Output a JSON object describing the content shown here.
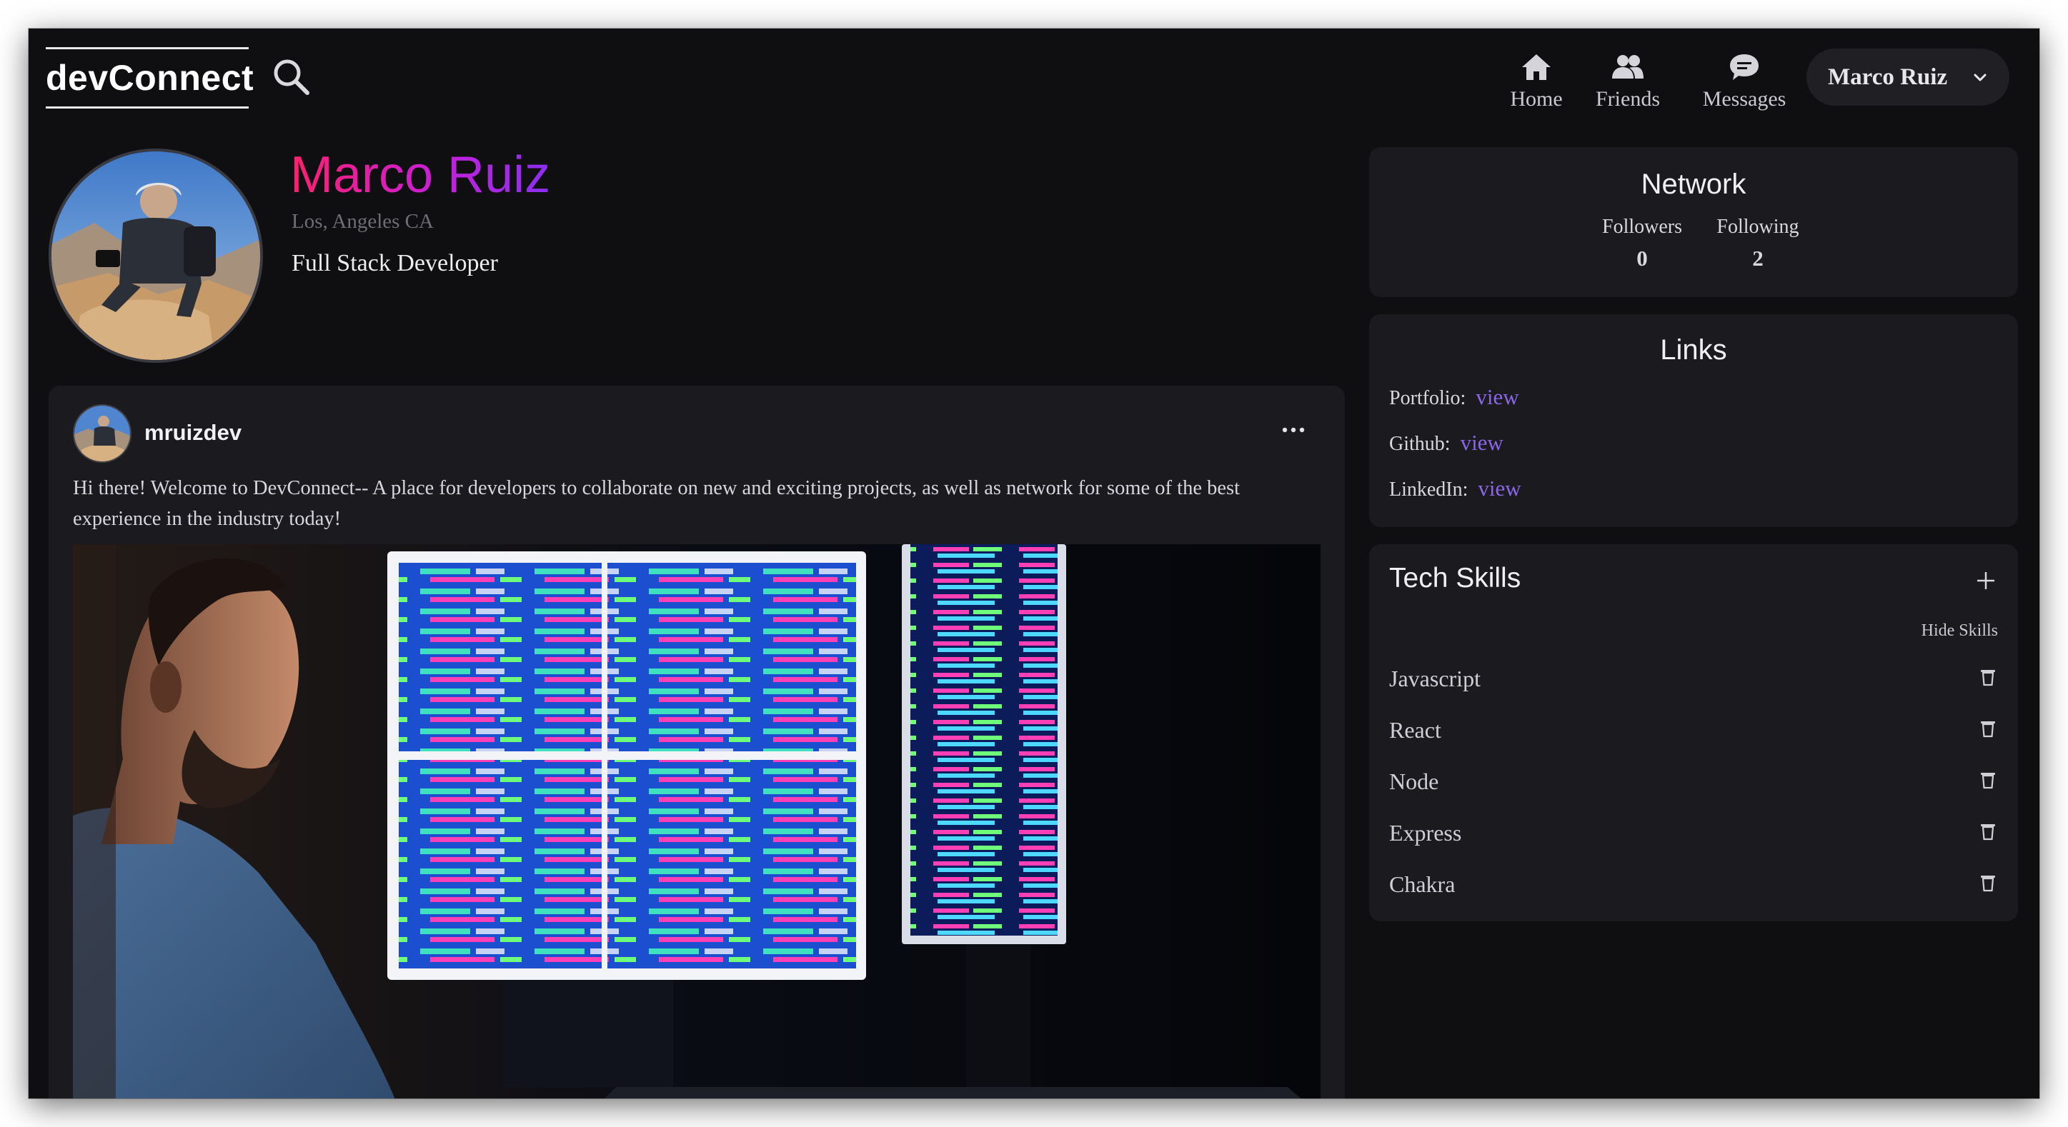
{
  "nav": {
    "logo": "devConnect",
    "items": [
      {
        "label": "Home",
        "icon": "home-icon"
      },
      {
        "label": "Friends",
        "icon": "friends-icon"
      },
      {
        "label": "Messages",
        "icon": "messages-icon"
      }
    ],
    "user_menu": "Marco Ruiz"
  },
  "profile": {
    "name": "Marco Ruiz",
    "location": "Los, Angeles CA",
    "role": "Full Stack Developer"
  },
  "post": {
    "username": "mruizdev",
    "text": "Hi there! Welcome to DevConnect-- A place for developers to collaborate on new and exciting projects, as well as network for some of the best experience in the industry today!"
  },
  "network": {
    "title": "Network",
    "followers_label": "Followers",
    "followers": "0",
    "following_label": "Following",
    "following": "2"
  },
  "links": {
    "title": "Links",
    "items": [
      {
        "label": "Portfolio:",
        "link": "view"
      },
      {
        "label": "Github:",
        "link": "view"
      },
      {
        "label": "LinkedIn:",
        "link": "view"
      }
    ]
  },
  "skills": {
    "title": "Tech Skills",
    "hide_label": "Hide Skills",
    "items": [
      "Javascript",
      "React",
      "Node",
      "Express",
      "Chakra"
    ]
  },
  "colors": {
    "background": "#0f0f12",
    "card": "#1a1a1f",
    "accent_link": "#8a67e8",
    "name_gradient_start": "#ff1f6d",
    "name_gradient_end": "#8b2ff2"
  }
}
